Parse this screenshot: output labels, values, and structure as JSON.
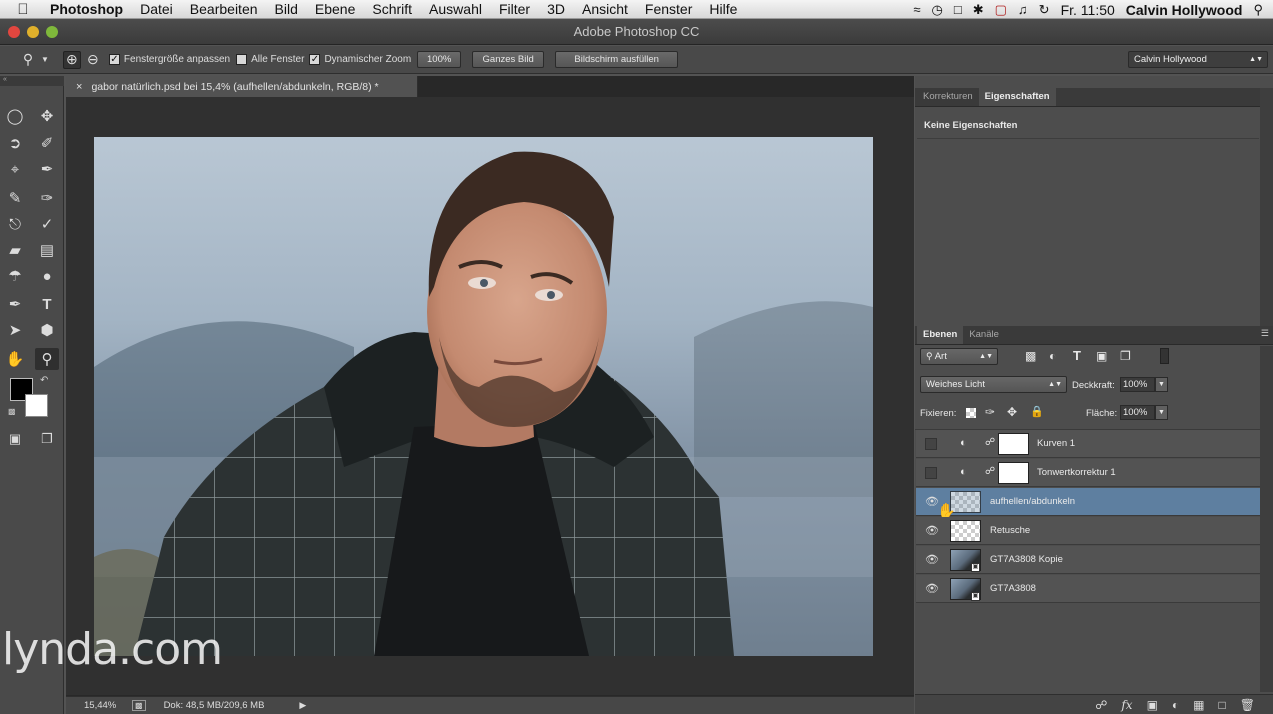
{
  "menubar": {
    "items": [
      "Photoshop",
      "Datei",
      "Bearbeiten",
      "Bild",
      "Ebene",
      "Schrift",
      "Auswahl",
      "Filter",
      "3D",
      "Ansicht",
      "Fenster",
      "Hilfe"
    ],
    "clock": "Fr. 11:50",
    "user": "Calvin Hollywood"
  },
  "window": {
    "title": "Adobe Photoshop CC"
  },
  "options": {
    "fit_window": "Fenstergröße anpassen",
    "all_windows": "Alle Fenster",
    "dynamic_zoom": "Dynamischer Zoom",
    "zoom_pct": "100%",
    "whole_image": "Ganzes Bild",
    "fill_screen": "Bildschirm ausfüllen",
    "workspace": "Calvin Hollywood"
  },
  "document": {
    "tab_title": "gabor natürlich.psd bei 15,4% (aufhellen/abdunkeln, RGB/8) *",
    "zoom": "15,44%",
    "doc_info": "Dok: 48,5 MB/209,6 MB"
  },
  "properties": {
    "tabs": [
      "Korrekturen",
      "Eigenschaften"
    ],
    "message": "Keine Eigenschaften"
  },
  "layers_panel": {
    "tabs": [
      "Ebenen",
      "Kanäle"
    ],
    "filter": "Art",
    "blend_mode": "Weiches Licht",
    "opacity_label": "Deckkraft:",
    "opacity": "100%",
    "lock_label": "Fixieren:",
    "fill_label": "Fläche:",
    "fill": "100%",
    "layers": [
      {
        "name": "Kurven 1",
        "visible": false,
        "type": "adjustment"
      },
      {
        "name": "Tonwertkorrektur 1",
        "visible": false,
        "type": "adjustment"
      },
      {
        "name": "aufhellen/abdunkeln",
        "visible": true,
        "type": "pixel",
        "selected": true
      },
      {
        "name": "Retusche",
        "visible": true,
        "type": "pixel"
      },
      {
        "name": "GT7A3808 Kopie",
        "visible": true,
        "type": "smart"
      },
      {
        "name": "GT7A3808",
        "visible": true,
        "type": "smart"
      }
    ]
  },
  "watermark": "lynda.com",
  "colors": {
    "selected_layer": "#5e7fa0",
    "panel_bg": "#4d4d4d",
    "canvas_bg": "#282828"
  }
}
